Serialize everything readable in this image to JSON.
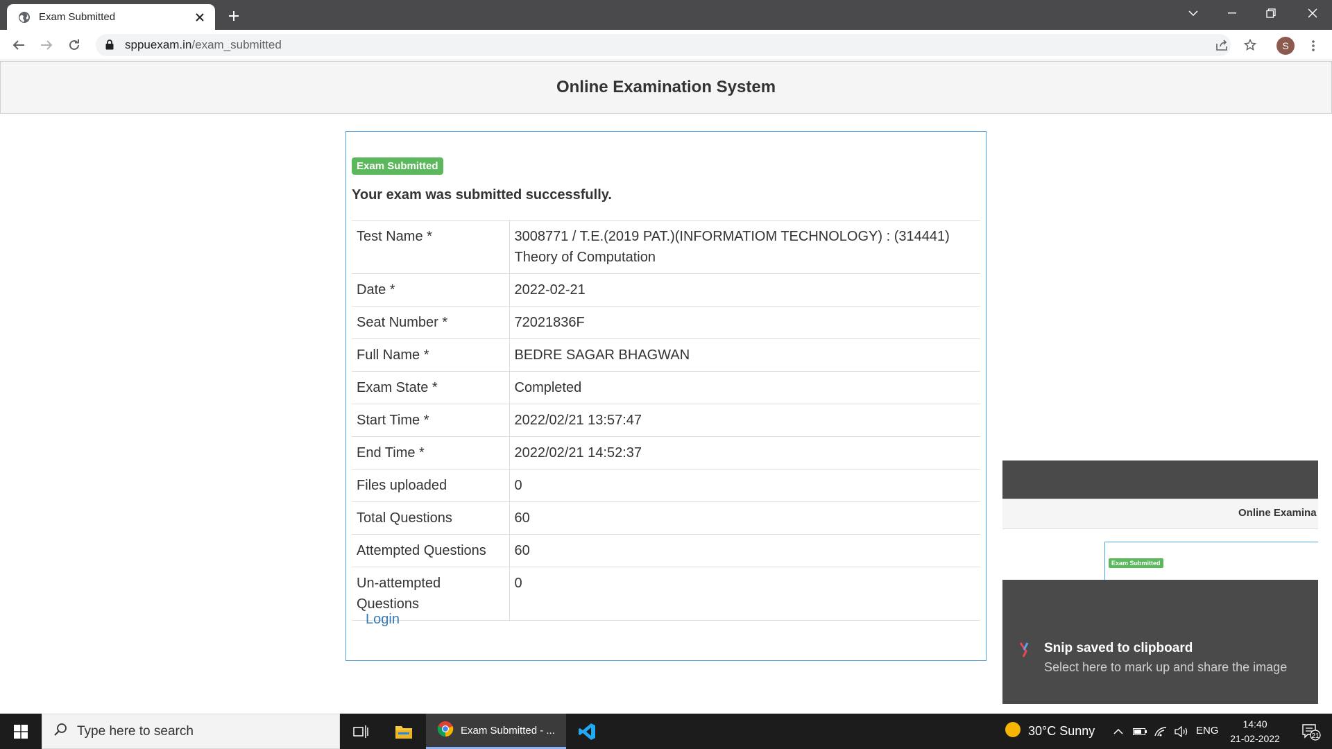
{
  "browser": {
    "tab_title": "Exam Submitted",
    "url_host": "sppuexam.in",
    "url_path": "/exam_submitted",
    "profile_initial": "S"
  },
  "page": {
    "title": "Online Examination System",
    "badge": "Exam Submitted",
    "success_message": "Your exam was submitted successfully.",
    "details": [
      {
        "label": "Test Name *",
        "value": "3008771 / T.E.(2019 PAT.)(INFORMATIOM TECHNOLOGY) : (314441) Theory of Computation"
      },
      {
        "label": "Date *",
        "value": "2022-02-21"
      },
      {
        "label": "Seat Number *",
        "value": "72021836F"
      },
      {
        "label": "Full Name *",
        "value": "BEDRE SAGAR BHAGWAN"
      },
      {
        "label": "Exam State *",
        "value": "Completed"
      },
      {
        "label": "Start Time *",
        "value": "2022/02/21 13:57:47"
      },
      {
        "label": "End Time *",
        "value": "2022/02/21 14:52:37"
      },
      {
        "label": "Files uploaded",
        "value": "0"
      },
      {
        "label": "Total Questions",
        "value": "60"
      },
      {
        "label": "Attempted Questions",
        "value": "60"
      },
      {
        "label": "Un-attempted Questions",
        "value": "0"
      }
    ],
    "login_link": "Login"
  },
  "snip_notification": {
    "thumb_title": "Online Examina",
    "thumb_badge": "Exam Submitted",
    "heading": "Snip saved to clipboard",
    "body": "Select here to mark up and share the image"
  },
  "taskbar": {
    "search_placeholder": "Type here to search",
    "active_app_label": "Exam Submitted - ...",
    "weather": "30°C  Sunny",
    "language": "ENG",
    "time": "14:40",
    "date": "21-02-2022",
    "notification_count": "21"
  },
  "colors": {
    "badge_green": "#5cb85c",
    "link_blue": "#337ab7",
    "card_border": "#4aa3df",
    "chrome_frame": "#4a4a4c",
    "taskbar": "#1c1c1c"
  }
}
